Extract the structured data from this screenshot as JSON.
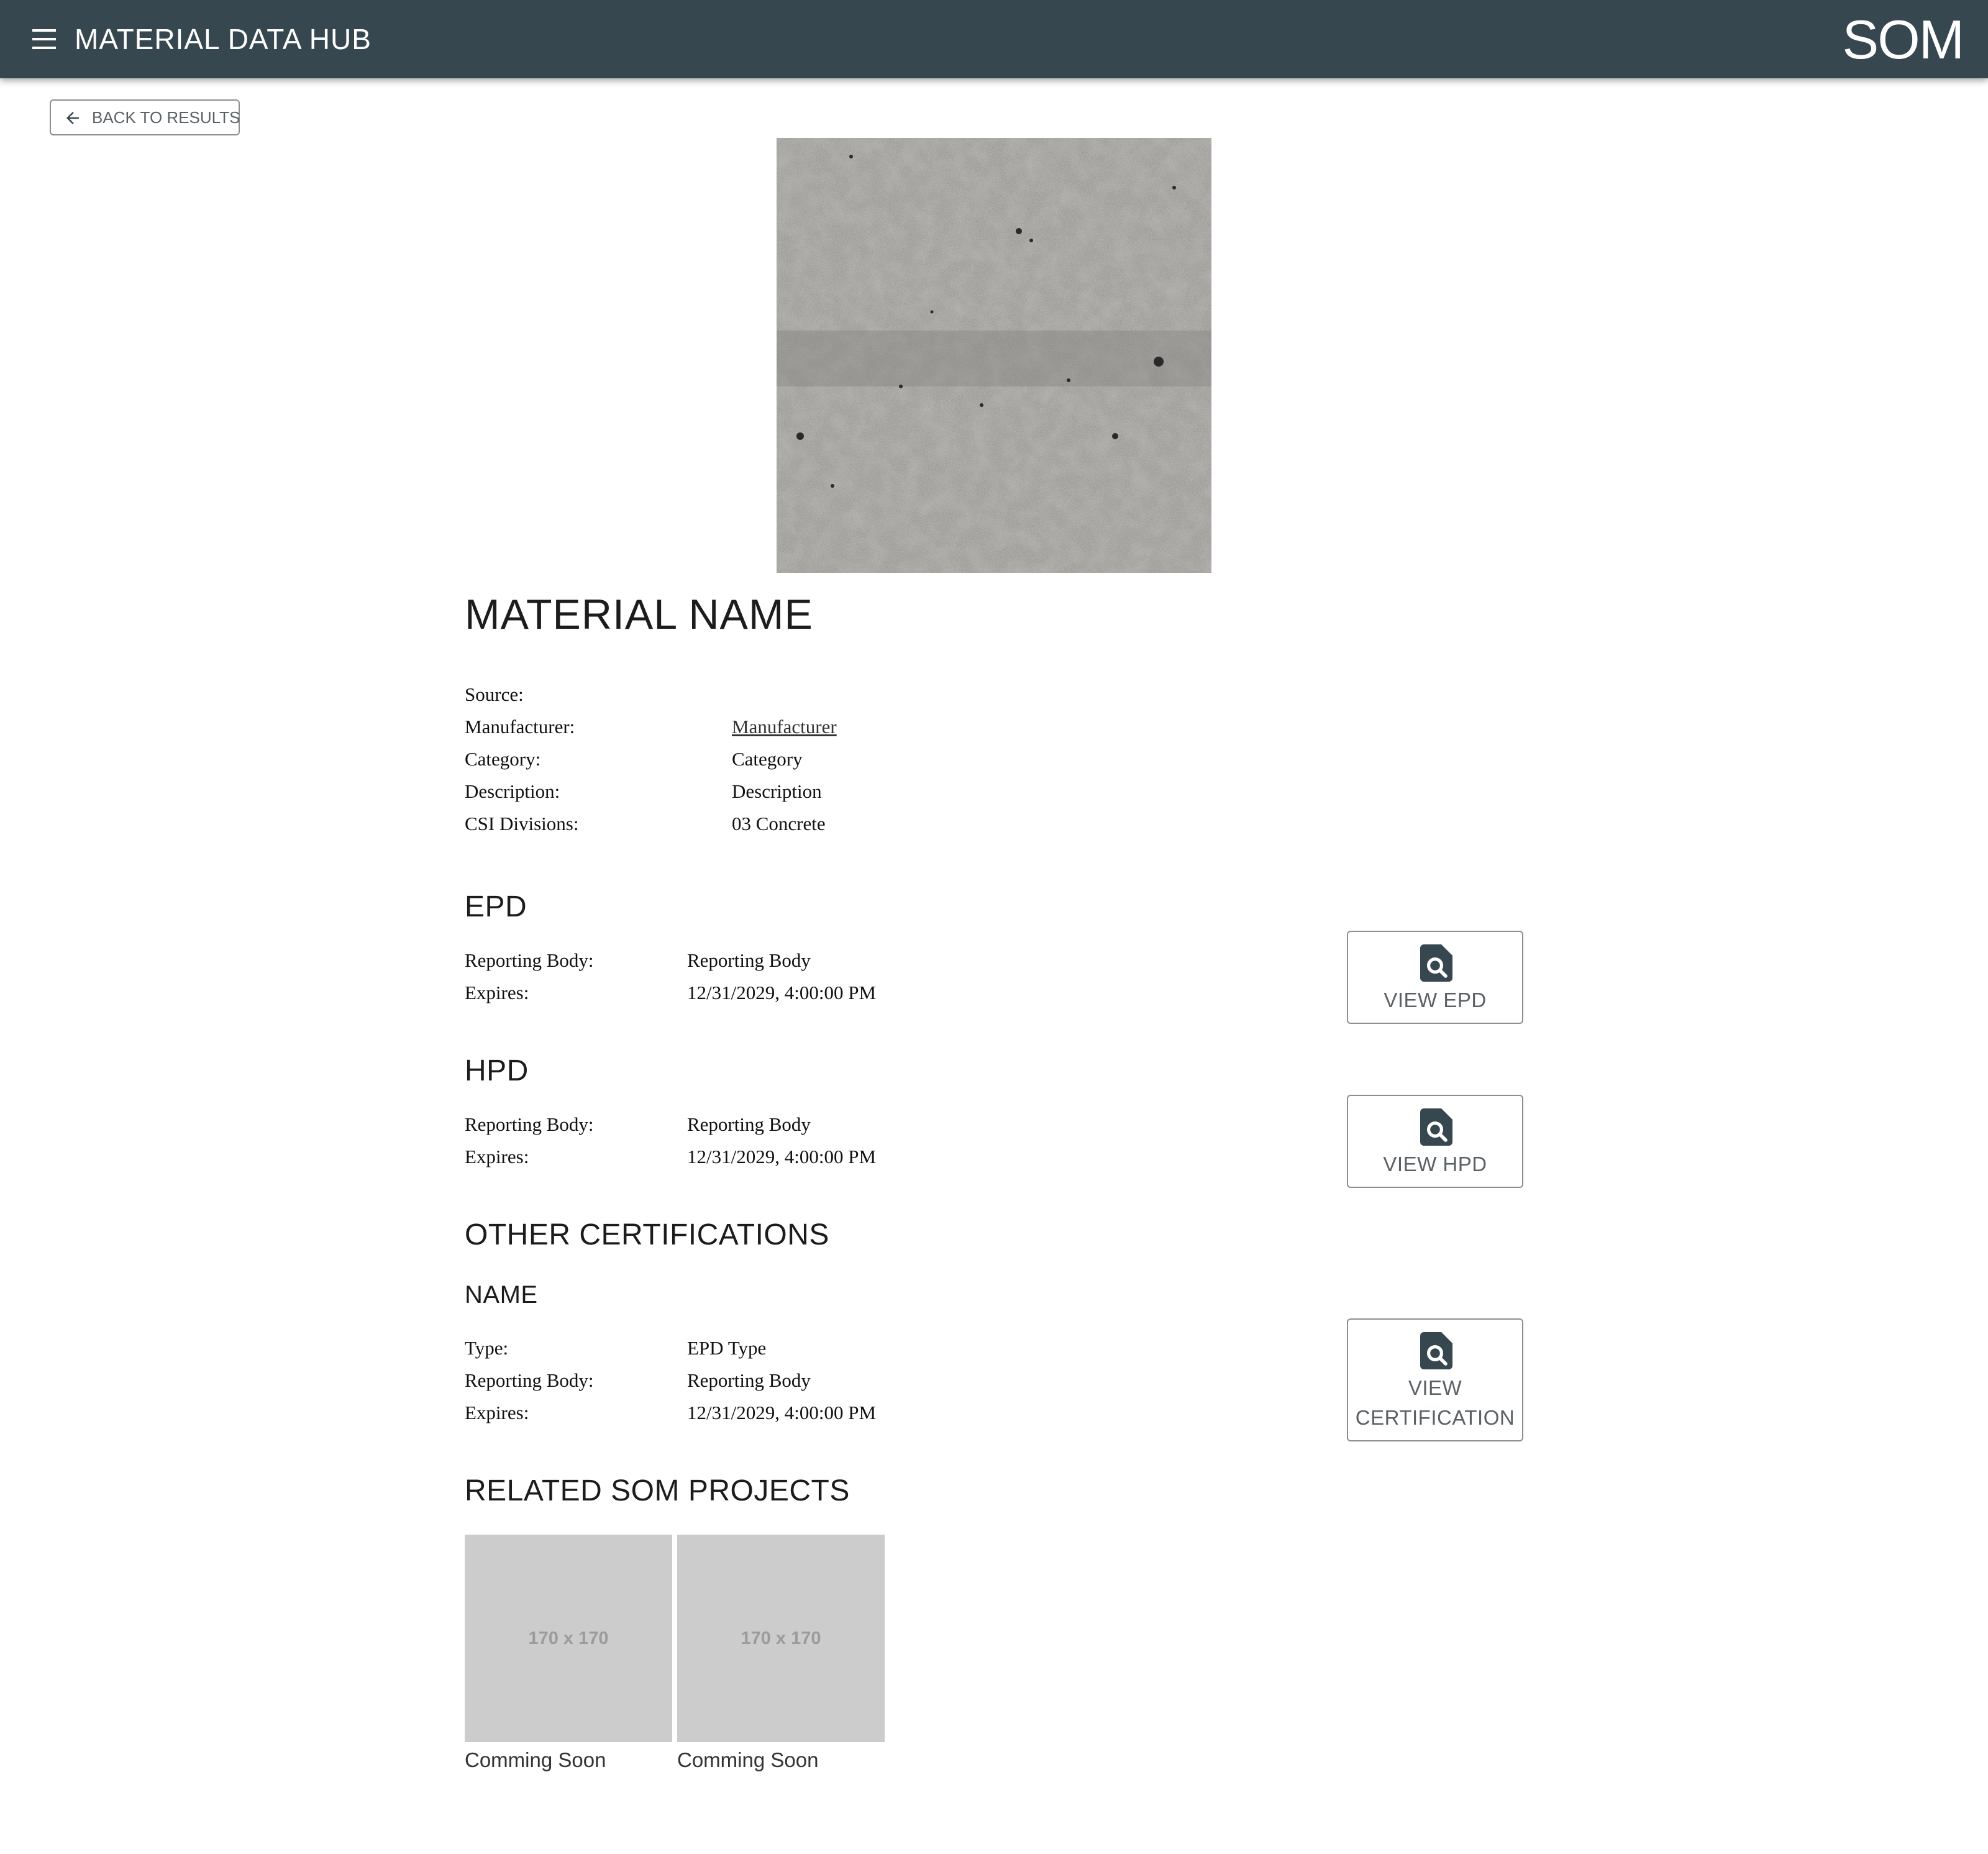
{
  "header": {
    "app_title": "MATERIAL DATA HUB",
    "brand": "SOM",
    "menu_icon": "hamburger-menu-icon",
    "background_color": "#37474f"
  },
  "back_button": {
    "label": "BACK TO RESULTS",
    "icon": "arrow-left-icon"
  },
  "material": {
    "image_description_icon": "concrete-texture-image",
    "title": "MATERIAL NAME",
    "details": [
      {
        "label": "Source:",
        "value": ""
      },
      {
        "label": "Manufacturer:",
        "value": "Manufacturer",
        "link": true
      },
      {
        "label": "Category:",
        "value": "Category"
      },
      {
        "label": "Description:",
        "value": "Description"
      },
      {
        "label": "CSI Divisions:",
        "value": "03 Concrete"
      }
    ]
  },
  "epd": {
    "heading": "EPD",
    "rows": [
      {
        "label": "Reporting Body:",
        "value": "Reporting Body"
      },
      {
        "label": "Expires:",
        "value": "12/31/2029, 4:00:00 PM"
      }
    ],
    "button_label": "VIEW EPD"
  },
  "hpd": {
    "heading": "HPD",
    "rows": [
      {
        "label": "Reporting Body:",
        "value": "Reporting Body"
      },
      {
        "label": "Expires:",
        "value": "12/31/2029, 4:00:00 PM"
      }
    ],
    "button_label": "VIEW HPD"
  },
  "other_certifications": {
    "heading": "OTHER CERTIFICATIONS",
    "items": [
      {
        "name": "NAME",
        "rows": [
          {
            "label": "Type:",
            "value": "EPD Type"
          },
          {
            "label": "Reporting Body:",
            "value": "Reporting Body"
          },
          {
            "label": "Expires:",
            "value": "12/31/2029, 4:00:00 PM"
          }
        ],
        "button_line1": "VIEW",
        "button_line2": "CERTIFICATION"
      }
    ]
  },
  "related_projects": {
    "heading": "RELATED SOM PROJECTS",
    "items": [
      {
        "placeholder": "170 x 170",
        "caption": "Comming Soon"
      },
      {
        "placeholder": "170 x 170",
        "caption": "Comming Soon"
      }
    ]
  },
  "colors": {
    "header_bg": "#37474f",
    "button_border": "#8a8f92",
    "button_text": "#5a6165",
    "placeholder_bg": "#cccccc",
    "icon_color": "#37474f"
  }
}
